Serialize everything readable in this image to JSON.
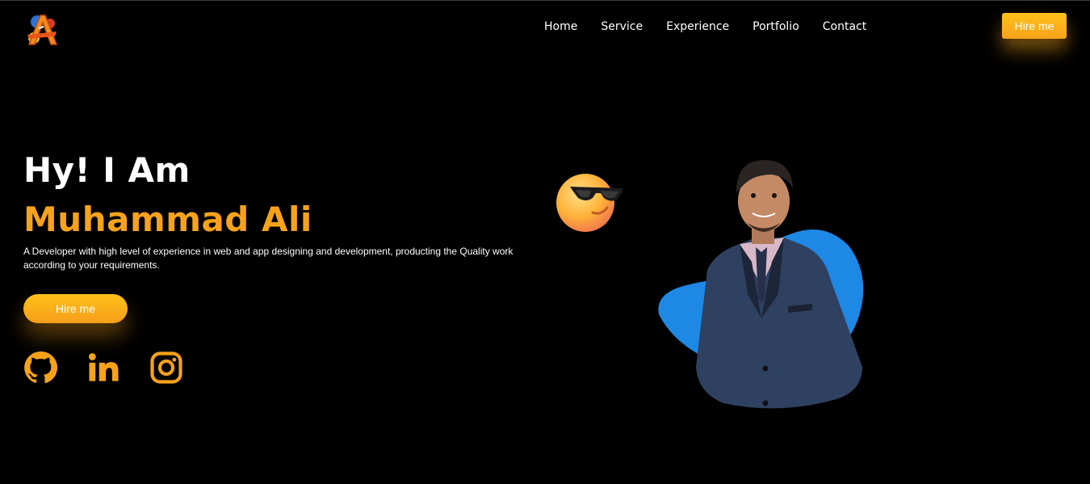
{
  "header": {
    "logo_icon": "logo-a-icon",
    "nav": [
      {
        "label": "Home"
      },
      {
        "label": "Service"
      },
      {
        "label": "Experience"
      },
      {
        "label": "Portfolio"
      },
      {
        "label": "Contact"
      }
    ],
    "hire_label": "Hire me"
  },
  "hero": {
    "greeting": "Hy! I Am",
    "name": "Muhammad Ali",
    "description": "A Developer with high level of experience in web and app designing and development, producting the Quality work according to your requirements.",
    "hire_label": "Hire me",
    "socials": [
      {
        "icon": "github-icon"
      },
      {
        "icon": "linkedin-icon"
      },
      {
        "icon": "instagram-icon"
      }
    ],
    "emoji_icon": "sunglasses-emoji-icon",
    "portrait": "profile-portrait"
  },
  "colors": {
    "background": "#000000",
    "accent": "#f7a21b",
    "accent_light": "#ffc21a",
    "blob_blue": "#1e88e5",
    "text": "#ffffff"
  }
}
